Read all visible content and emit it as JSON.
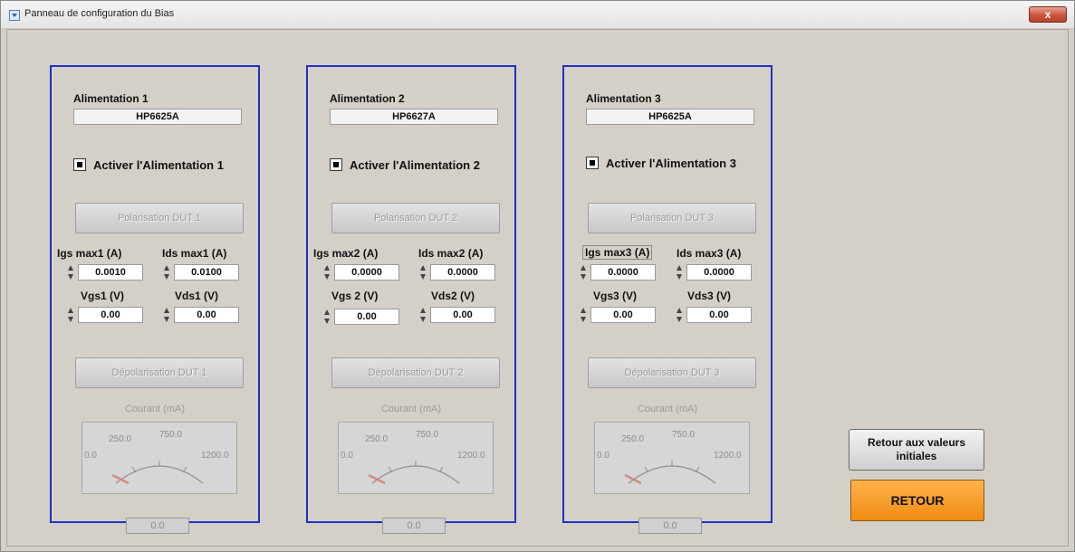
{
  "window": {
    "title": "Panneau de configuration du Bias",
    "close_glyph": "x",
    "title_icon": "window-app-icon"
  },
  "panels": [
    {
      "label": "Alimentation 1",
      "model": "HP6625A",
      "enable_label": "Activer l'Alimentation 1",
      "enable_checked": true,
      "polarise_label": "Polarisation DUT 1",
      "igs_label": "Igs max1 (A)",
      "ids_label": "Ids max1 (A)",
      "igs_value": "0.0010",
      "ids_value": "0.0100",
      "vgs_label": "Vgs1 (V)",
      "vds_label": "Vds1 (V)",
      "vgs_value": "0.00",
      "vds_value": "0.00",
      "depolarise_label": "Dépolarisation DUT 1",
      "gauge_title": "Courant (mA)",
      "gauge_ticks": [
        "0.0",
        "250.0",
        "750.0",
        "1200.0"
      ],
      "gauge_readout": "0.0"
    },
    {
      "label": "Alimentation 2",
      "model": "HP6627A",
      "enable_label": "Activer l'Alimentation 2",
      "enable_checked": true,
      "polarise_label": "Polarisation DUT 2",
      "igs_label": "Igs max2 (A)",
      "ids_label": "Ids max2 (A)",
      "igs_value": "0.0000",
      "ids_value": "0.0000",
      "vgs_label": "Vgs 2 (V)",
      "vds_label": "Vds2 (V)",
      "vgs_value": "0.00",
      "vds_value": "0.00",
      "depolarise_label": "Dépolarisation DUT 2",
      "gauge_title": "Courant (mA)",
      "gauge_ticks": [
        "0.0",
        "250.0",
        "750.0",
        "1200.0"
      ],
      "gauge_readout": "0.0"
    },
    {
      "label": "Alimentation 3",
      "model": "HP6625A",
      "enable_label": "Activer l'Alimentation 3",
      "enable_checked": true,
      "polarise_label": "Polarisation DUT 3",
      "igs_label": "Igs max3 (A)",
      "ids_label": "Ids max3 (A)",
      "igs_value": "0.0000",
      "ids_value": "0.0000",
      "vgs_label": "Vgs3 (V)",
      "vds_label": "Vds3 (V)",
      "vgs_value": "0.00",
      "vds_value": "0.00",
      "depolarise_label": "Dépolarisation DUT 3",
      "gauge_title": "Courant (mA)",
      "gauge_ticks": [
        "0.0",
        "250.0",
        "750.0",
        "1200.0"
      ],
      "gauge_readout": "0.0"
    }
  ],
  "actions": {
    "reset_label": "Retour aux valeurs initiales",
    "return_label": "RETOUR"
  },
  "colors": {
    "panel_border": "#2030c8",
    "return_button": "#f08c12",
    "gauge_needle": "#d08a8a"
  }
}
